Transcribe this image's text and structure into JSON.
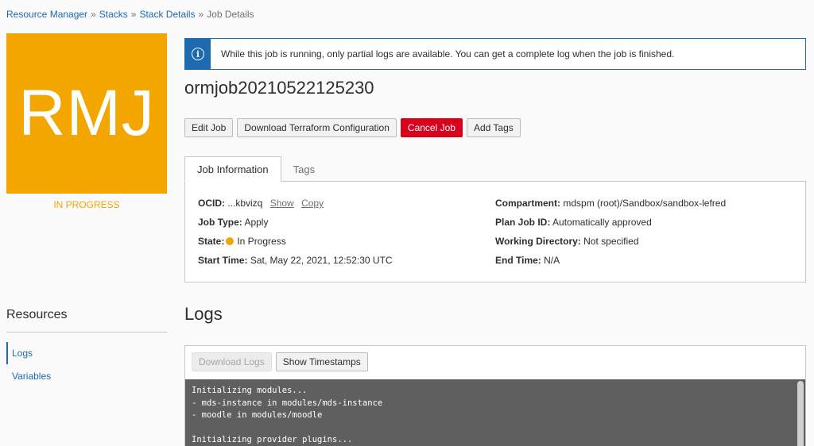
{
  "breadcrumb": {
    "items": [
      "Resource Manager",
      "Stacks",
      "Stack Details"
    ],
    "separator": "»",
    "current": "Job Details"
  },
  "tile": {
    "initials": "RMJ",
    "status": "IN PROGRESS",
    "color": "#f3a500"
  },
  "notice": {
    "icon": "info-icon",
    "message": "While this job is running, only partial logs are available. You can get a complete log when the job is finished."
  },
  "job": {
    "title": "ormjob20210522125230"
  },
  "actions": {
    "edit": "Edit Job",
    "download_config": "Download Terraform Configuration",
    "cancel": "Cancel Job",
    "add_tags": "Add Tags"
  },
  "tabs": {
    "info": "Job Information",
    "tags": "Tags"
  },
  "info": {
    "ocid_label": "OCID:",
    "ocid_value": "...kbvizq",
    "show": "Show",
    "copy": "Copy",
    "job_type_label": "Job Type:",
    "job_type_value": "Apply",
    "state_label": "State:",
    "state_value": "In Progress",
    "start_label": "Start Time:",
    "start_value": "Sat, May 22, 2021, 12:52:30 UTC",
    "compartment_label": "Compartment:",
    "compartment_value": "mdspm (root)/Sandbox/sandbox-lefred",
    "plan_label": "Plan Job ID:",
    "plan_value": "Automatically approved",
    "workdir_label": "Working Directory:",
    "workdir_value": "Not specified",
    "end_label": "End Time:",
    "end_value": "N/A"
  },
  "resources": {
    "title": "Resources",
    "items": [
      "Logs",
      "Variables"
    ]
  },
  "logs": {
    "title": "Logs",
    "download": "Download Logs",
    "show_timestamps": "Show Timestamps",
    "lines": "Initializing modules...\n- mds-instance in modules/mds-instance\n- moodle in modules/moodle\n\nInitializing provider plugins..."
  },
  "colors": {
    "link": "#1d6ab0",
    "danger": "#d8001b",
    "progress": "#f3a500"
  }
}
